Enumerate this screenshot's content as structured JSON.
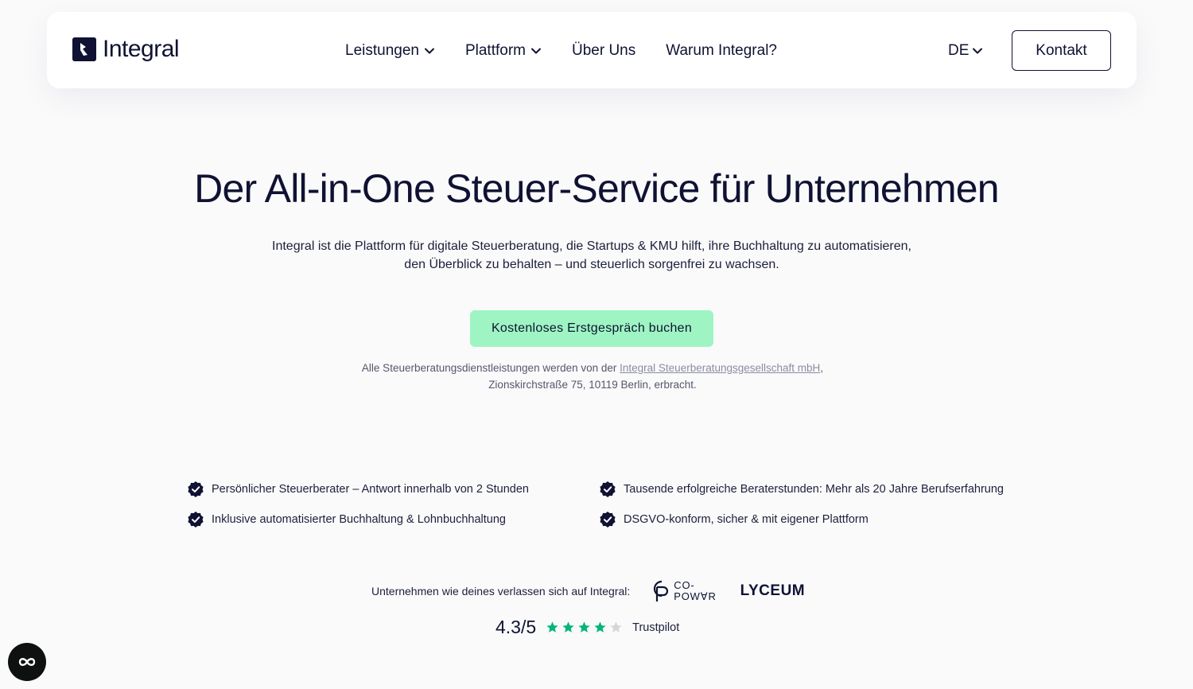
{
  "brand": {
    "name": "Integral"
  },
  "nav": {
    "items": [
      {
        "label": "Leistungen",
        "dropdown": true
      },
      {
        "label": "Plattform",
        "dropdown": true
      },
      {
        "label": "Über Uns",
        "dropdown": false
      },
      {
        "label": "Warum Integral?",
        "dropdown": false
      }
    ],
    "language": "DE",
    "contact_label": "Kontakt"
  },
  "hero": {
    "title": "Der All-in-One Steuer-Service für Unternehmen",
    "subtitle_line1": "Integral ist die Plattform für digitale Steuerberatung, die Startups & KMU hilft, ihre Buchhaltung zu automatisieren,",
    "subtitle_line2": "den Überblick zu behalten – und steuerlich sorgenfrei zu wachsen.",
    "cta_label": "Kostenloses Erstgespräch buchen"
  },
  "legal": {
    "prefix": "Alle Steuerberatungsdienstleistungen werden von der ",
    "link_text": "Integral Steuerberatungsgesellschaft mbH",
    "suffix": ",",
    "line2": "Zionskirchstraße 75, 10119 Berlin, erbracht."
  },
  "features": [
    "Persönlicher Steuerberater – Antwort innerhalb von 2 Stunden",
    "Tausende erfolgreiche Beraterstunden: Mehr als 20 Jahre Berufserfahrung",
    "Inklusive automatisierter Buchhaltung & Lohnbuchhaltung",
    "DSGVO-konform, sicher & mit eigener Plattform"
  ],
  "trust": {
    "text": "Unternehmen wie deines verlassen sich auf Integral:",
    "logo1_line1": "CO-",
    "logo1_line2": "POW∀R",
    "logo2": "LYCEUM",
    "rating": "4.3/5",
    "rating_value": 4.3,
    "rating_max": 5,
    "source": "Trustpilot"
  },
  "colors": {
    "navy": "#0f1232",
    "cta_green": "#9ef5c3",
    "star_green": "#00b67a",
    "star_gray": "#d6d6d6"
  }
}
